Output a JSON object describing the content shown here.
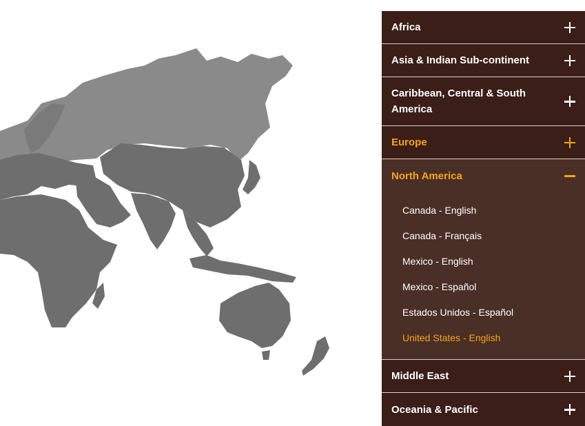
{
  "regions": [
    {
      "label": "Africa",
      "toggle": "plus-icon",
      "state": "collapsed"
    },
    {
      "label": "Asia & Indian Sub-continent",
      "toggle": "plus-icon",
      "state": "collapsed"
    },
    {
      "label": "Caribbean, Central & South America",
      "toggle": "plus-icon",
      "state": "collapsed"
    },
    {
      "label": "Europe",
      "toggle": "plus-icon",
      "state": "highlighted"
    },
    {
      "label": "North America",
      "toggle": "minus-icon",
      "state": "expanded",
      "links": [
        {
          "label": "Canada - English"
        },
        {
          "label": "Canada - Français"
        },
        {
          "label": "Mexico - English"
        },
        {
          "label": "Mexico - Español"
        },
        {
          "label": "Estados Unidos - Español"
        },
        {
          "label": "United States - English",
          "current": true
        }
      ]
    },
    {
      "label": "Middle East",
      "toggle": "plus-icon",
      "state": "collapsed"
    },
    {
      "label": "Oceania & Pacific",
      "toggle": "plus-icon",
      "state": "collapsed"
    }
  ],
  "colors": {
    "panel_bg": "#3a1e17",
    "expanded_bg": "#4a2f27",
    "accent": "#f7a31c",
    "text": "#ffffff",
    "map_land": "#6e6e6e",
    "map_highlight": "#8a8a8a"
  }
}
